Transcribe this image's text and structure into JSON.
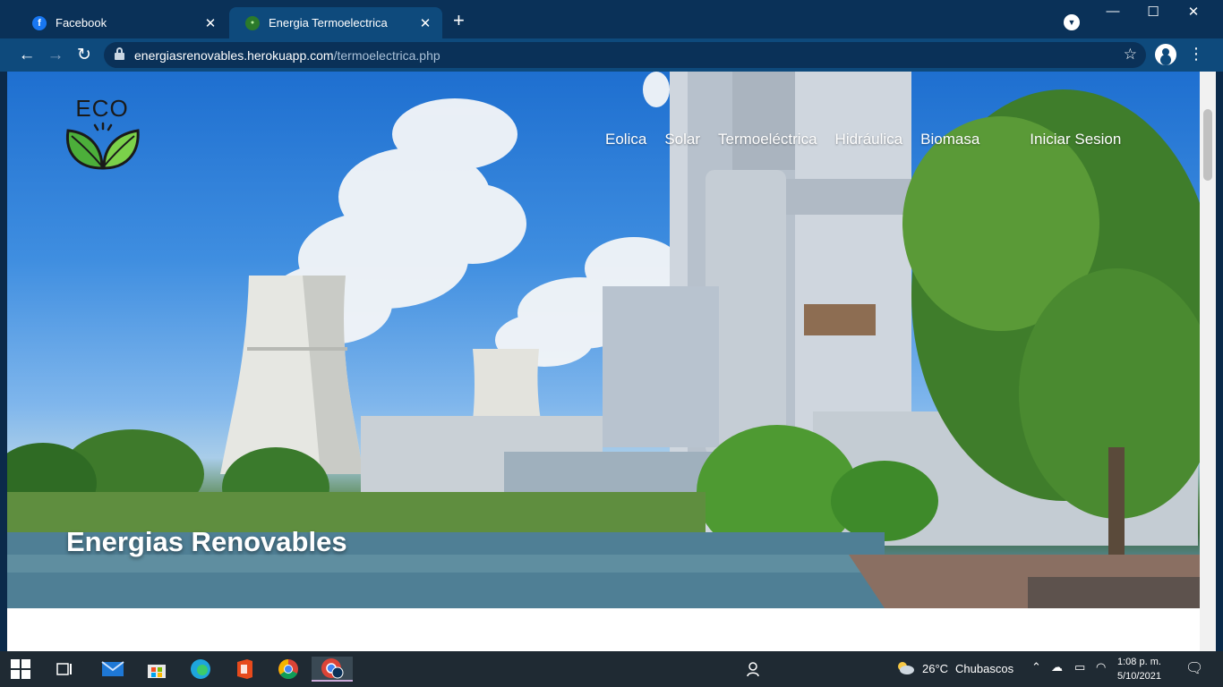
{
  "browser": {
    "tabs": [
      {
        "title": "Facebook",
        "close": "✕"
      },
      {
        "title": "Energia Termoelectrica",
        "close": "✕"
      }
    ],
    "new_tab": "+",
    "url_host": "energiasrenovables.herokuapp.com",
    "url_path": "/termoelectrica.php",
    "controls": {
      "minimize": "—",
      "maximize": "☐",
      "close": "✕"
    }
  },
  "site": {
    "logo_text": "ECO",
    "nav": [
      {
        "label": "Eolica"
      },
      {
        "label": "Solar"
      },
      {
        "label": "Termoeléctrica"
      },
      {
        "label": "Hidráulica"
      },
      {
        "label": "Biomasa"
      }
    ],
    "login_label": "Iniciar Sesion",
    "hero_title": "Energias Renovables"
  },
  "taskbar": {
    "weather_temp": "26°C",
    "weather_desc": "Chubascos",
    "time": "1:08 p. m.",
    "date": "5/10/2021"
  },
  "colors": {
    "tab_bar": "#0a3158",
    "toolbar": "#0e4a7c",
    "taskbar": "#1f2a33",
    "leaf_green": "#5bbf3f"
  }
}
